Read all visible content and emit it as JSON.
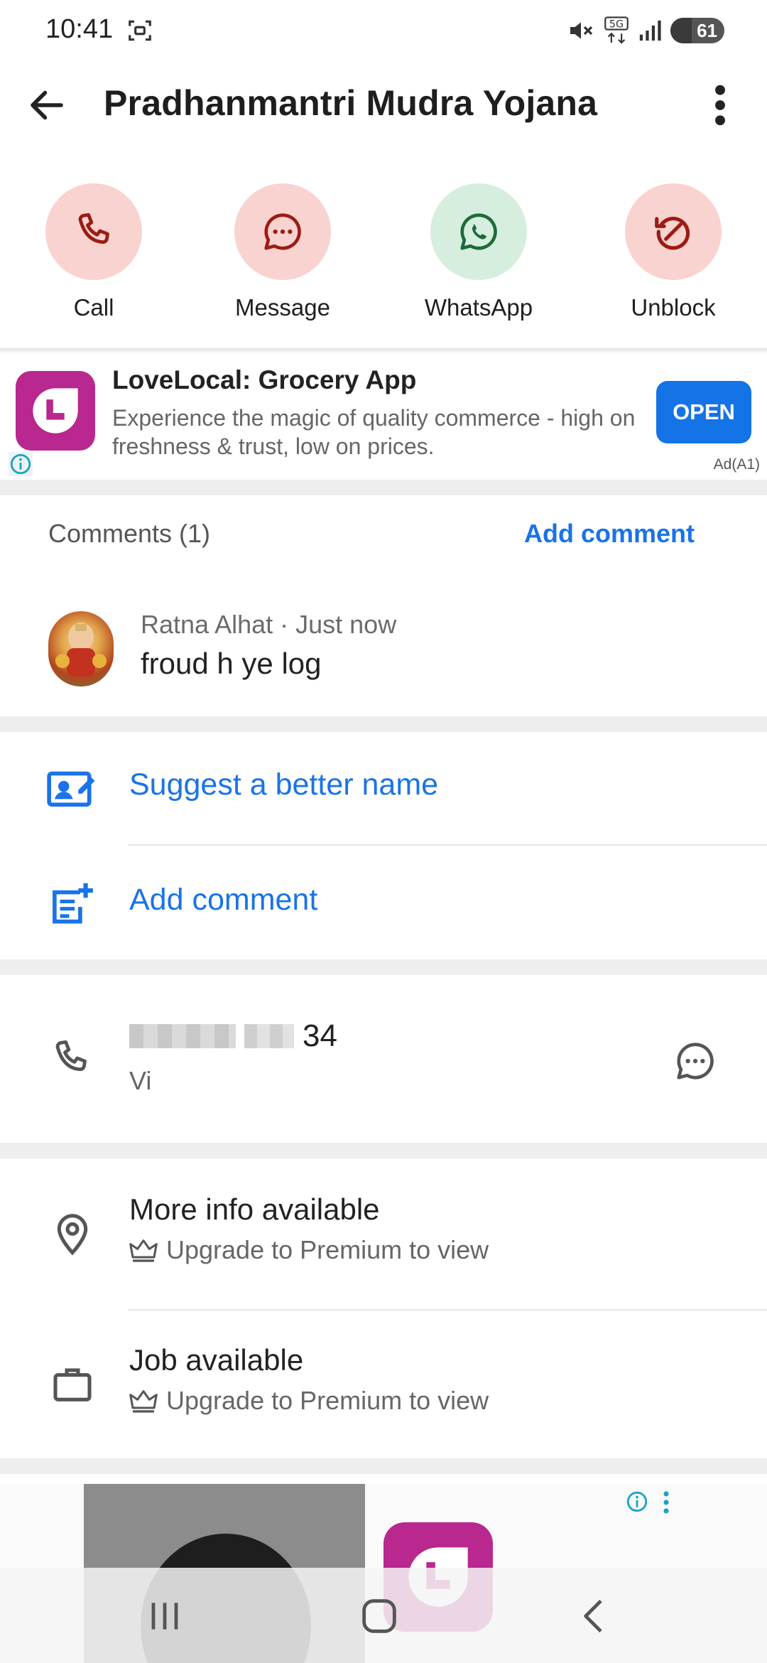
{
  "status_bar": {
    "time": "10:41",
    "network": "5G",
    "battery": "61"
  },
  "app_bar": {
    "title": "Pradhanmantri Mudra Yojana"
  },
  "actions": [
    {
      "label": "Call",
      "icon": "phone-icon"
    },
    {
      "label": "Message",
      "icon": "chat-bubble-icon"
    },
    {
      "label": "WhatsApp",
      "icon": "whatsapp-icon"
    },
    {
      "label": "Unblock",
      "icon": "unblock-icon"
    }
  ],
  "ad": {
    "app_name": "LoveLocal: Grocery App",
    "description": "Experience the magic of quality commerce - high on freshness & trust, low on prices.",
    "cta": "OPEN",
    "tag": "Ad(A1)"
  },
  "comments": {
    "header": "Comments (1)",
    "add_label": "Add comment",
    "items": [
      {
        "author_time": "Ratna Alhat · Just now",
        "text": "froud h ye log"
      }
    ]
  },
  "links": {
    "suggest_name": "Suggest a better name",
    "add_comment": "Add comment"
  },
  "phone": {
    "number_tail": "34",
    "carrier": "Vi"
  },
  "info_rows": [
    {
      "title": "More info available",
      "subtitle": "Upgrade to Premium to view",
      "icon": "location-pin-icon"
    },
    {
      "title": "Job available",
      "subtitle": "Upgrade to Premium to view",
      "icon": "briefcase-icon"
    }
  ],
  "colors": {
    "accent": "#1a73e8",
    "danger_bg": "#f9d3cf",
    "danger_fg": "#b3261e",
    "whatsapp_bg": "#d6eedd",
    "whatsapp_fg": "#1e6b3a",
    "brand_ad": "#b8288e",
    "cta": "#1473e6"
  }
}
